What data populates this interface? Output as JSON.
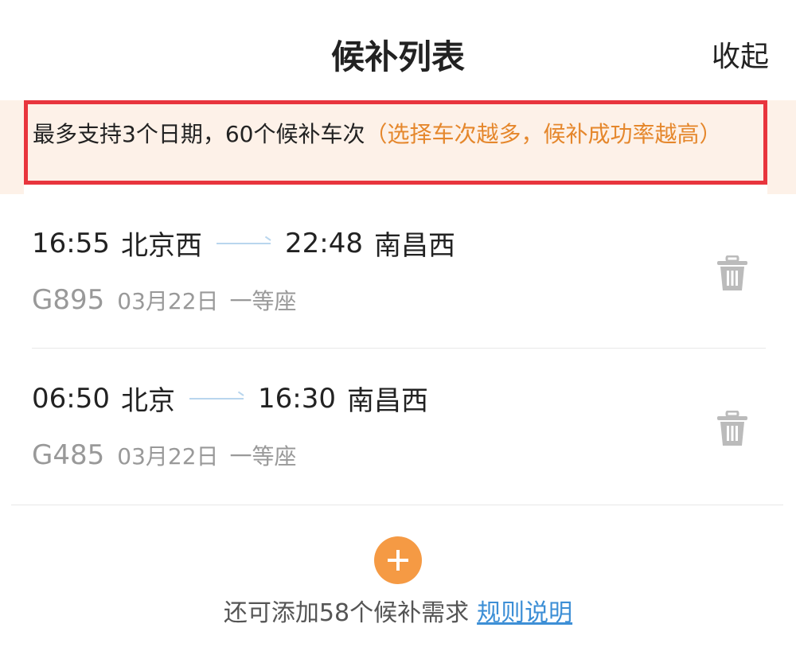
{
  "header": {
    "title": "候补列表",
    "collapse_label": "收起"
  },
  "notice": {
    "main_text": "最多支持3个日期，60个候补车次",
    "hint_text": "（选择车次越多，候补成功率越高）",
    "border_color": "#e8353d",
    "background": "#fdf1e8",
    "hint_color": "#e5872c"
  },
  "items": [
    {
      "depart_time": "16:55",
      "from": "北京西",
      "arrive_time": "22:48",
      "to": "南昌西",
      "train": "G895",
      "date": "03月22日",
      "seat": "一等座",
      "delete_icon": "trash-icon"
    },
    {
      "depart_time": "06:50",
      "from": "北京",
      "arrive_time": "16:30",
      "to": "南昌西",
      "train": "G485",
      "date": "03月22日",
      "seat": "一等座",
      "delete_icon": "trash-icon"
    }
  ],
  "footer": {
    "add_icon": "plus-icon",
    "remaining_text": "还可添加58个候补需求",
    "rules_link": "规则说明",
    "accent": "#f59a44",
    "link_color": "#3d8fd6"
  }
}
